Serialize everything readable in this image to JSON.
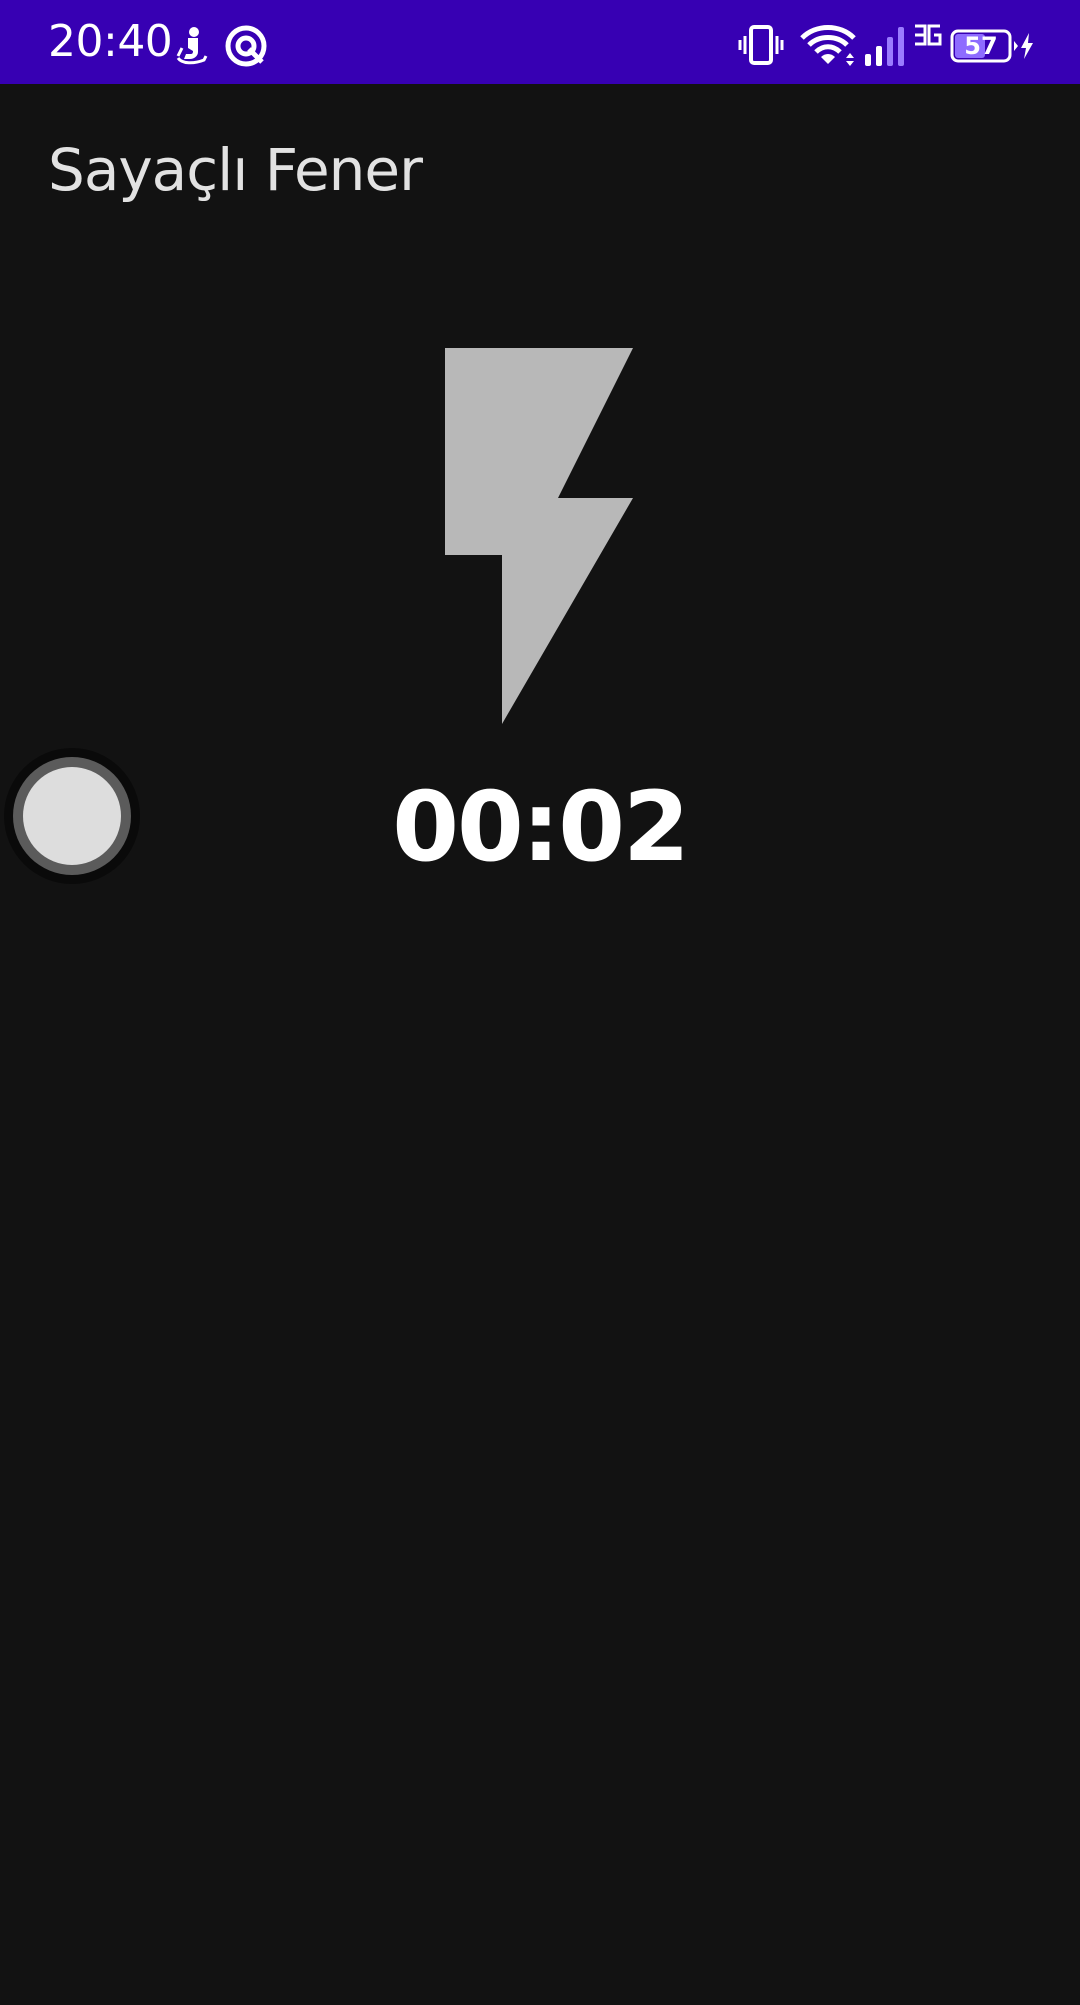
{
  "status_bar": {
    "time": "20:40",
    "background_color": "#3700b3",
    "left_icons": [
      "running-person-icon",
      "circular-app-icon"
    ],
    "right_icons": [
      "vibrate-icon",
      "wifi-icon",
      "signal-icon",
      "3g-icon",
      "battery-icon",
      "charging-icon"
    ],
    "network_type": "3G",
    "battery_level": "57"
  },
  "app": {
    "title": "Sayaçlı Fener",
    "background_color": "#121212"
  },
  "flashlight": {
    "icon": "flash-icon",
    "icon_color": "#b8b8b8",
    "timer": "00:02",
    "toggle_state": "off"
  }
}
